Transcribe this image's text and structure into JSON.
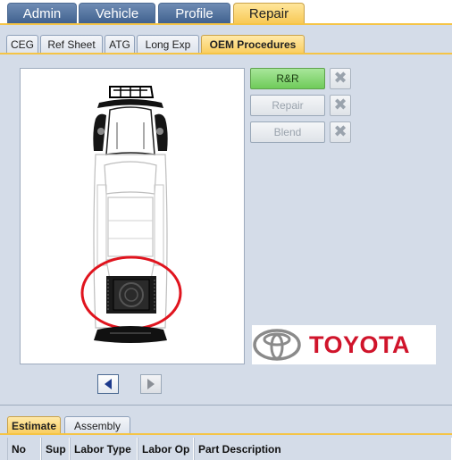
{
  "top_tabs": [
    "Admin",
    "Vehicle",
    "Profile",
    "Repair"
  ],
  "sub_tabs": [
    "CEG",
    "Ref Sheet",
    "ATG",
    "Long Exp",
    "OEM Procedures"
  ],
  "actions": {
    "rr_label": "R&R",
    "repair_label": "Repair",
    "blend_label": "Blend"
  },
  "logo": {
    "brand": "TOYOTA",
    "brand_color": "#d0142b"
  },
  "bottom_tabs": [
    "Estimate",
    "Assembly"
  ],
  "table": {
    "columns": [
      "No",
      "Sup",
      "Labor Type",
      "Labor Op",
      "Part Description"
    ]
  },
  "colors": {
    "highlight_ring": "#e0141e",
    "accent": "#f5c445"
  }
}
